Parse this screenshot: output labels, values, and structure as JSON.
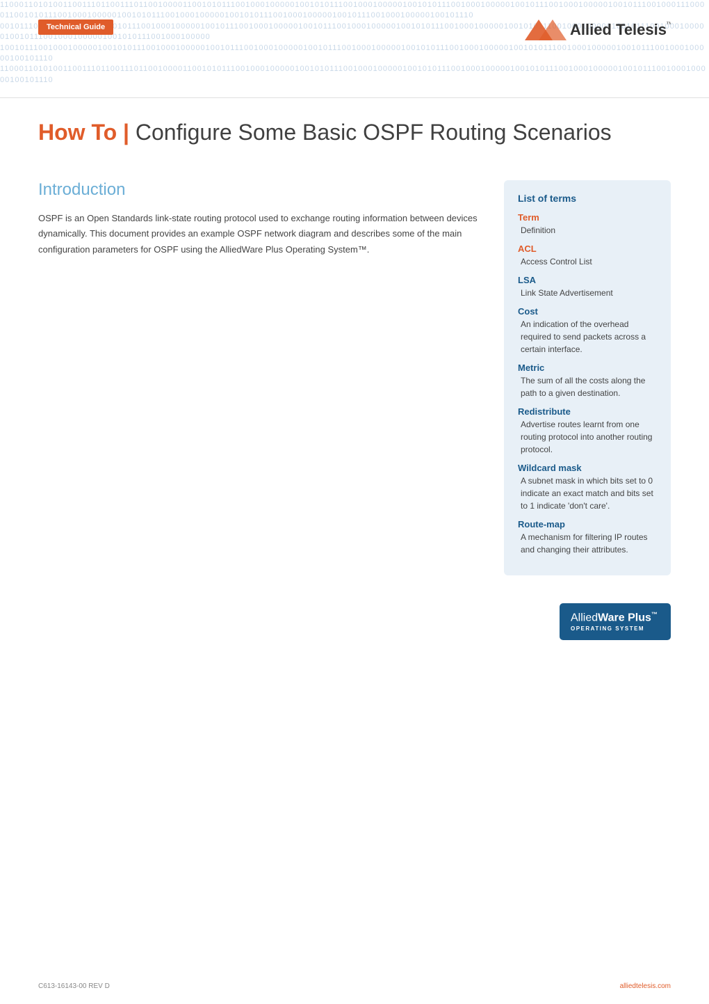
{
  "header": {
    "badge_label": "Technical Guide",
    "logo_text": "Allied Telesis",
    "binary_text": "11000110101001100111011001110110010000110010101110010001000001001010111001000100000100101011100100010000010101110010001"
  },
  "title": {
    "prefix": "How To |",
    "text": " Configure Some Basic OSPF Routing Scenarios"
  },
  "intro": {
    "heading": "Introduction",
    "body": "OSPF is an Open Standards link-state routing protocol used to exchange routing information between devices dynamically. This document provides an example OSPF network diagram and describes some of the main configuration parameters for OSPF using the AlliedWare Plus Operating System™."
  },
  "terms_box": {
    "title": "List of terms",
    "terms": [
      {
        "name": "Term",
        "definition": "Definition",
        "name_color": "orange"
      },
      {
        "name": "ACL",
        "definition": "Access Control List",
        "name_color": "orange"
      },
      {
        "name": "LSA",
        "definition": "Link State Advertisement",
        "name_color": "blue"
      },
      {
        "name": "Cost",
        "definition": "An indication of the overhead required to send packets across a certain interface.",
        "name_color": "blue"
      },
      {
        "name": "Metric",
        "definition": "The sum of all the costs along the path to a given destination.",
        "name_color": "blue"
      },
      {
        "name": "Redistribute",
        "definition": "Advertise routes learnt from one routing protocol into another routing protocol.",
        "name_color": "blue"
      },
      {
        "name": "Wildcard mask",
        "definition": "A subnet mask in which bits set to 0 indicate an exact match and bits set to 1 indicate 'don't care'.",
        "name_color": "blue"
      },
      {
        "name": "Route-map",
        "definition": "A mechanism for filtering IP routes and changing their attributes.",
        "name_color": "blue"
      }
    ]
  },
  "alliedware_badge": {
    "brand_top_regular": "Allied",
    "brand_top_bold": "Ware Plus",
    "brand_sup": "™",
    "brand_bottom": "OPERATING SYSTEM"
  },
  "footer": {
    "left": "C613-16143-00 REV D",
    "right": "alliedtelesis.com"
  }
}
